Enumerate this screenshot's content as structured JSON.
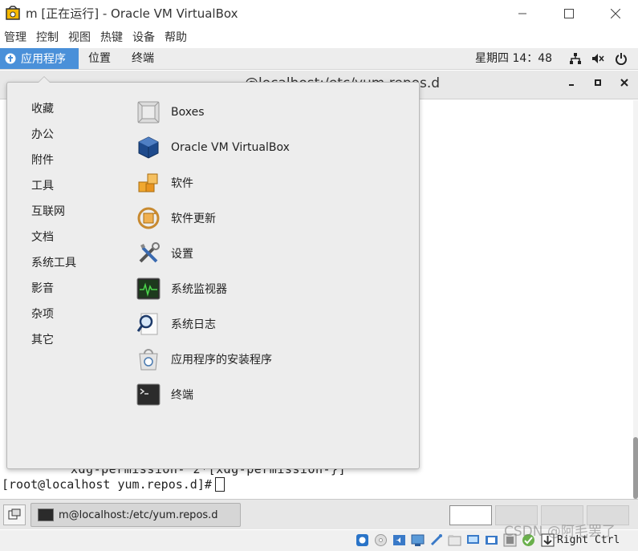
{
  "window": {
    "title": "m [正在运行] - Oracle VM VirtualBox"
  },
  "host_menu": [
    "管理",
    "控制",
    "视图",
    "热键",
    "设备",
    "帮助"
  ],
  "guest_topbar": {
    "apps_label": "应用程序",
    "places_label": "位置",
    "terminal_label": "终端",
    "clock": "星期四 14：48"
  },
  "terminal_window": {
    "title": "@localhost:/etc/yum.repos.d",
    "line1": "xdg-permission-    2*[xdg-permission-}]",
    "prompt": "[root@localhost yum.repos.d]#"
  },
  "apps_menu": {
    "categories": [
      "收藏",
      "办公",
      "附件",
      "工具",
      "互联网",
      "文档",
      "系统工具",
      "影音",
      "杂项",
      "其它"
    ],
    "apps": [
      {
        "label": "Boxes",
        "icon": "boxes-icon"
      },
      {
        "label": "Oracle VM VirtualBox",
        "icon": "virtualbox-icon"
      },
      {
        "label": "软件",
        "icon": "software-icon"
      },
      {
        "label": "软件更新",
        "icon": "software-update-icon"
      },
      {
        "label": "设置",
        "icon": "settings-tools-icon"
      },
      {
        "label": "系统监视器",
        "icon": "system-monitor-icon"
      },
      {
        "label": "系统日志",
        "icon": "system-log-icon"
      },
      {
        "label": "应用程序的安装程序",
        "icon": "app-installer-icon"
      },
      {
        "label": "终端",
        "icon": "terminal-icon"
      }
    ]
  },
  "taskbar": {
    "task_label": "m@localhost:/etc/yum.repos.d"
  },
  "status_bar": {
    "host_key": "Right Ctrl",
    "watermark": "CSDN @阿毛罢了"
  },
  "colors": {
    "accent": "#4a90d9",
    "menu_bg": "#ededed"
  }
}
